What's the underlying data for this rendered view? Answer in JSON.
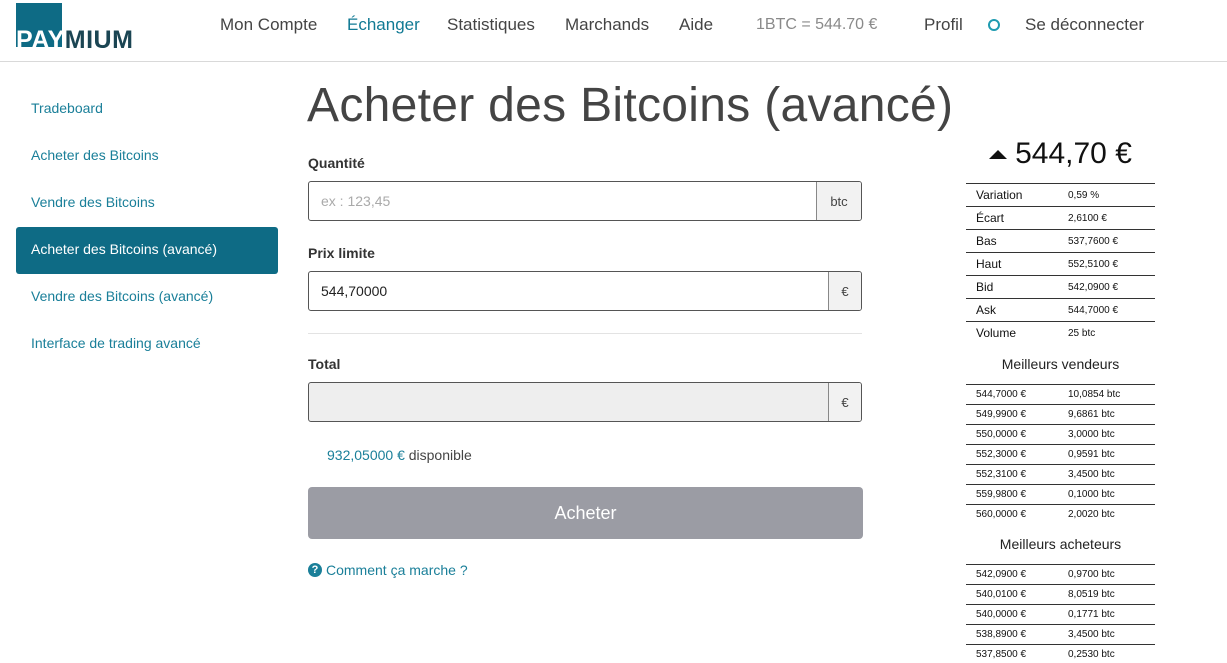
{
  "header": {
    "logo": {
      "pay": "PAY",
      "rest": "MIUM"
    },
    "nav": [
      {
        "label": "Mon Compte"
      },
      {
        "label": "Échanger"
      },
      {
        "label": "Statistiques"
      },
      {
        "label": "Marchands"
      },
      {
        "label": "Aide"
      }
    ],
    "rate": "1BTC = 544.70 €",
    "profile": "Profil",
    "logout": "Se déconnecter"
  },
  "sidebar": {
    "items": [
      {
        "label": "Tradeboard"
      },
      {
        "label": "Acheter des Bitcoins"
      },
      {
        "label": "Vendre des Bitcoins"
      },
      {
        "label": "Acheter des Bitcoins (avancé)"
      },
      {
        "label": "Vendre des Bitcoins (avancé)"
      },
      {
        "label": "Interface de trading avancé"
      }
    ]
  },
  "main": {
    "title": "Acheter des Bitcoins (avancé)",
    "quantity_label": "Quantité",
    "quantity_placeholder": "ex : 123,45",
    "quantity_unit": "btc",
    "limit_label": "Prix limite",
    "limit_value": "544,70000",
    "limit_unit": "€",
    "total_label": "Total",
    "total_value": "",
    "total_unit": "€",
    "available_amount": "932,05000 €",
    "available_text": "disponible",
    "buy_label": "Acheter",
    "help_label": "Comment ça marche ?"
  },
  "ticker": {
    "price": "544,70 €",
    "stats": [
      {
        "k": "Variation",
        "v": "0,59 %"
      },
      {
        "k": "Écart",
        "v": "2,6100 €"
      },
      {
        "k": "Bas",
        "v": "537,7600 €"
      },
      {
        "k": "Haut",
        "v": "552,5100 €"
      },
      {
        "k": "Bid",
        "v": "542,0900 €"
      },
      {
        "k": "Ask",
        "v": "544,7000 €"
      },
      {
        "k": "Volume",
        "v": "25 btc"
      }
    ],
    "sellers_title": "Meilleurs vendeurs",
    "sellers": [
      {
        "p": "544,7000 €",
        "q": "10,0854 btc"
      },
      {
        "p": "549,9900 €",
        "q": "9,6861 btc"
      },
      {
        "p": "550,0000 €",
        "q": "3,0000 btc"
      },
      {
        "p": "552,3000 €",
        "q": "0,9591 btc"
      },
      {
        "p": "552,3100 €",
        "q": "3,4500 btc"
      },
      {
        "p": "559,9800 €",
        "q": "0,1000 btc"
      },
      {
        "p": "560,0000 €",
        "q": "2,0020 btc"
      }
    ],
    "buyers_title": "Meilleurs acheteurs",
    "buyers": [
      {
        "p": "542,0900 €",
        "q": "0,9700 btc"
      },
      {
        "p": "540,0100 €",
        "q": "8,0519 btc"
      },
      {
        "p": "540,0000 €",
        "q": "0,1771 btc"
      },
      {
        "p": "538,8900 €",
        "q": "3,4500 btc"
      },
      {
        "p": "537,8500 €",
        "q": "0,2530 btc"
      }
    ]
  }
}
